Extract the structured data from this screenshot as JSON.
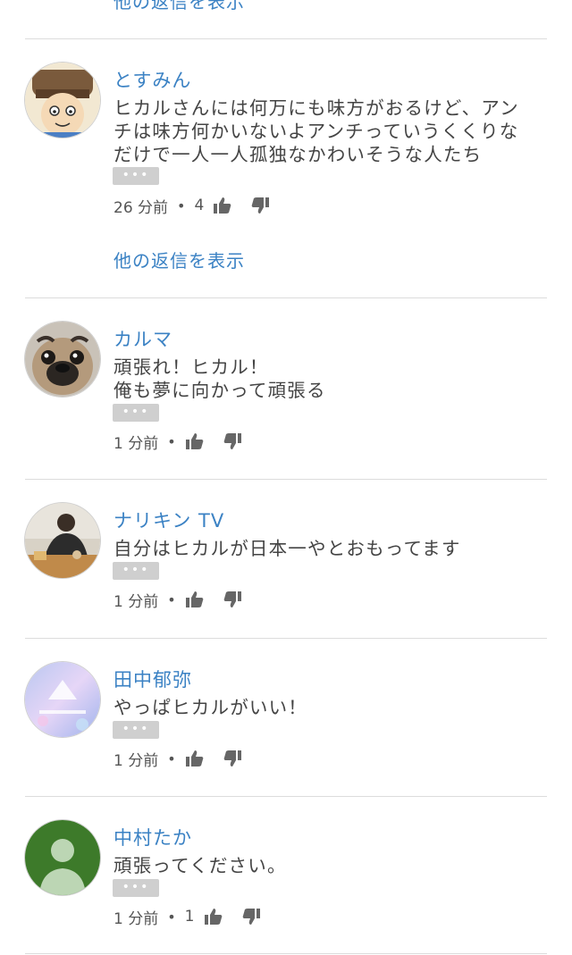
{
  "top_link": "他の返信を表示",
  "comments": [
    {
      "author": "とすみん",
      "text": [
        "ヒカルさんには何万にも味方がおるけど、アン",
        "チは味方何かいないよアンチっていうくくりな",
        "だけで一人一人孤独なかわいそうな人たち"
      ],
      "more": "•••",
      "time": "26 分前",
      "sep": "•",
      "likes": "4",
      "replies_link": "他の返信を表示"
    },
    {
      "author": "カルマ",
      "text": [
        "頑張れ！ヒカル！",
        "俺も夢に向かって頑張る"
      ],
      "more": "•••",
      "time": "1 分前",
      "sep": "•"
    },
    {
      "author": "ナリキン TV",
      "text": [
        "自分はヒカルが日本一やとおもってます"
      ],
      "more": "•••",
      "time": "1 分前",
      "sep": "•"
    },
    {
      "author": "田中郁弥",
      "text": [
        "やっぱヒカルがいい！"
      ],
      "more": "•••",
      "time": "1 分前",
      "sep": "•"
    },
    {
      "author": "中村たか",
      "text": [
        "頑張ってください。"
      ],
      "more": "•••",
      "time": "1 分前",
      "sep": "•",
      "likes": "1"
    }
  ]
}
